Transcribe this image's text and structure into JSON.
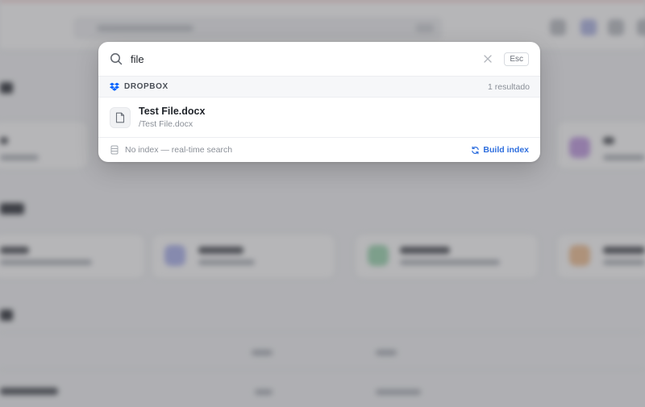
{
  "search": {
    "value": "file",
    "placeholder": "",
    "esc_label": "Esc"
  },
  "group": {
    "title": "DROPBOX",
    "count": "1 resultado",
    "icon": "dropbox-icon"
  },
  "results": [
    {
      "name": "Test File.docx",
      "path": "/Test File.docx",
      "icon": "file-icon"
    }
  ],
  "footer": {
    "status_text": "No index — real-time search",
    "build_label": "Build index"
  },
  "colors": {
    "accent": "#2f6fde",
    "dropbox": "#0061fe"
  }
}
